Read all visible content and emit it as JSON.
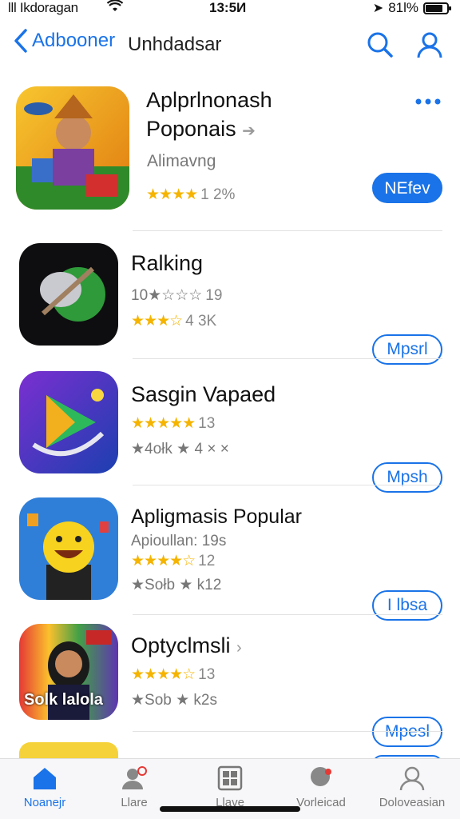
{
  "status": {
    "carrier": "lll Ikdoragan",
    "time": "13:5И",
    "battery": "81l%",
    "battery_level": 0.81
  },
  "nav": {
    "back_label": "Adbooner",
    "title": "Unhdadsar"
  },
  "apps": [
    {
      "name": "Aplprlnonash",
      "subtitle": "Poponais",
      "category": "Alimavng",
      "stars": "★★★★",
      "rating": "1 2%",
      "button": "NEfev"
    },
    {
      "name": "Ralking",
      "line1_stars": "10★☆☆☆",
      "line1_num": "19",
      "line2_stars": "★★★☆",
      "line2_num": "4 3K",
      "button": "Mpsrl"
    },
    {
      "name": "Sasgin Vapaed",
      "line1_stars": "★★★★★",
      "line1_num": "13",
      "line2_text": "★4ołk ★ 4 × ×",
      "button": "Mpsh"
    },
    {
      "name": "Apligmasis Popular",
      "line1_text": "Apioullan: 19s",
      "line2_stars": "★★★★☆",
      "line2_num": "12",
      "line3_text": "★Sołb ★ k12",
      "button": "I lbsa"
    },
    {
      "name": "Optyclmsli",
      "line1_stars": "★★★★☆",
      "line1_num": "13",
      "line2_text": "★Sob ★ k2s",
      "button": "Mpesl",
      "icon_text": "Solk lalola"
    }
  ],
  "tabs": [
    {
      "label": "Noanejr"
    },
    {
      "label": "Llare"
    },
    {
      "label": "Llave"
    },
    {
      "label": "Vorleicad"
    },
    {
      "label": "Doloveasian"
    }
  ],
  "colors": {
    "accent": "#1a73e8",
    "star": "#f5b400"
  }
}
